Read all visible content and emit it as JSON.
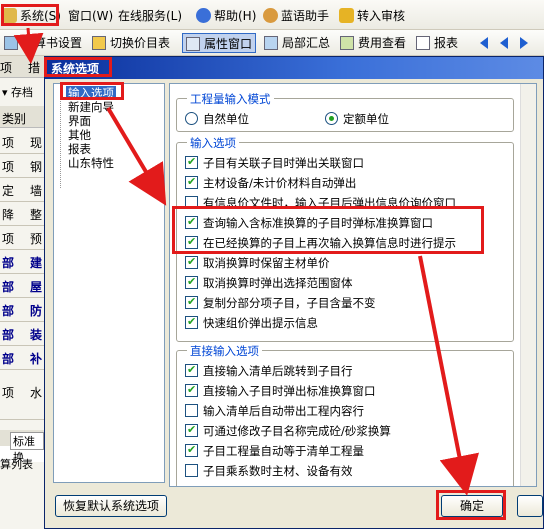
{
  "menu": {
    "items": [
      {
        "label": "系统(S)",
        "icon": "system-icon"
      },
      {
        "label": "窗口(W)",
        "icon": "window-icon"
      },
      {
        "label": "在线服务(L)",
        "icon": "online-icon"
      },
      {
        "label": "帮助(H)",
        "icon": "help-icon"
      },
      {
        "label": "蓝语助手",
        "icon": "assistant-icon"
      },
      {
        "label": "转入审核",
        "icon": "audit-icon"
      }
    ]
  },
  "toolbar": {
    "items": [
      {
        "label": "预算书设置",
        "icon": "budget-settings-icon"
      },
      {
        "label": "切换价目表",
        "icon": "switch-price-icon"
      },
      {
        "label": "属性窗口",
        "icon": "property-window-icon"
      },
      {
        "label": "局部汇总",
        "icon": "partial-summary-icon"
      },
      {
        "label": "费用查看",
        "icon": "cost-view-icon"
      },
      {
        "label": "报表",
        "icon": "report-icon"
      }
    ]
  },
  "background": {
    "tab1": "项",
    "tab2": "措",
    "save_label": "存档",
    "col_header": "类别",
    "rows": [
      {
        "c1": "项",
        "c2": "现"
      },
      {
        "c1": "项",
        "c2": "钢"
      },
      {
        "c1": "定",
        "c2": "墙"
      },
      {
        "c1": "降",
        "c2": "整"
      },
      {
        "c1": "项",
        "c2": "预"
      },
      {
        "c1": "部",
        "c2": "建"
      },
      {
        "c1": "部",
        "c2": "屋"
      },
      {
        "c1": "部",
        "c2": "防"
      },
      {
        "c1": "部",
        "c2": "装"
      },
      {
        "c1": "部",
        "c2": "补"
      },
      {
        "c1": "项",
        "c2": "水"
      }
    ],
    "bottom_tab": "标准换",
    "bottom_label": "算列表"
  },
  "dialog": {
    "title": "系统选项",
    "tree": [
      "输入选项",
      "新建向导",
      "界面",
      "其他",
      "报表",
      "山东特性"
    ],
    "groups": {
      "mode": {
        "title": "工程量输入模式",
        "options": [
          {
            "label": "自然单位",
            "checked": false
          },
          {
            "label": "定额单位",
            "checked": true
          }
        ]
      },
      "input": {
        "title": "输入选项",
        "options": [
          {
            "label": "子目有关联子目时弹出关联窗口",
            "checked": true
          },
          {
            "label": "主材设备/未计价材料自动弹出",
            "checked": true
          },
          {
            "label": "有信息价文件时，输入子目后弹出信息价询价窗口",
            "checked": false
          },
          {
            "label": "查询输入含标准换算的子目时弹标准换算窗口",
            "checked": true
          },
          {
            "label": "在已经换算的子目上再次输入换算信息时进行提示",
            "checked": true
          },
          {
            "label": "取消换算时保留主材单价",
            "checked": true
          },
          {
            "label": "取消换算时弹出选择范围窗体",
            "checked": true
          },
          {
            "label": "复制分部分项子目，子目含量不变",
            "checked": true
          },
          {
            "label": "快速组价弹出提示信息",
            "checked": true
          }
        ]
      },
      "direct": {
        "title": "直接输入选项",
        "options": [
          {
            "label": "直接输入清单后跳转到子目行",
            "checked": true
          },
          {
            "label": "直接输入子目时弹出标准换算窗口",
            "checked": true
          },
          {
            "label": "输入清单后自动带出工程内容行",
            "checked": false
          },
          {
            "label": "可通过修改子目名称完成砼/砂浆换算",
            "checked": true
          },
          {
            "label": "子目工程量自动等于清单工程量",
            "checked": true
          },
          {
            "label": "子目乘系数时主材、设备有效",
            "checked": false
          }
        ]
      }
    },
    "restore_button": "恢复默认系统选项",
    "ok_button": "确定"
  }
}
